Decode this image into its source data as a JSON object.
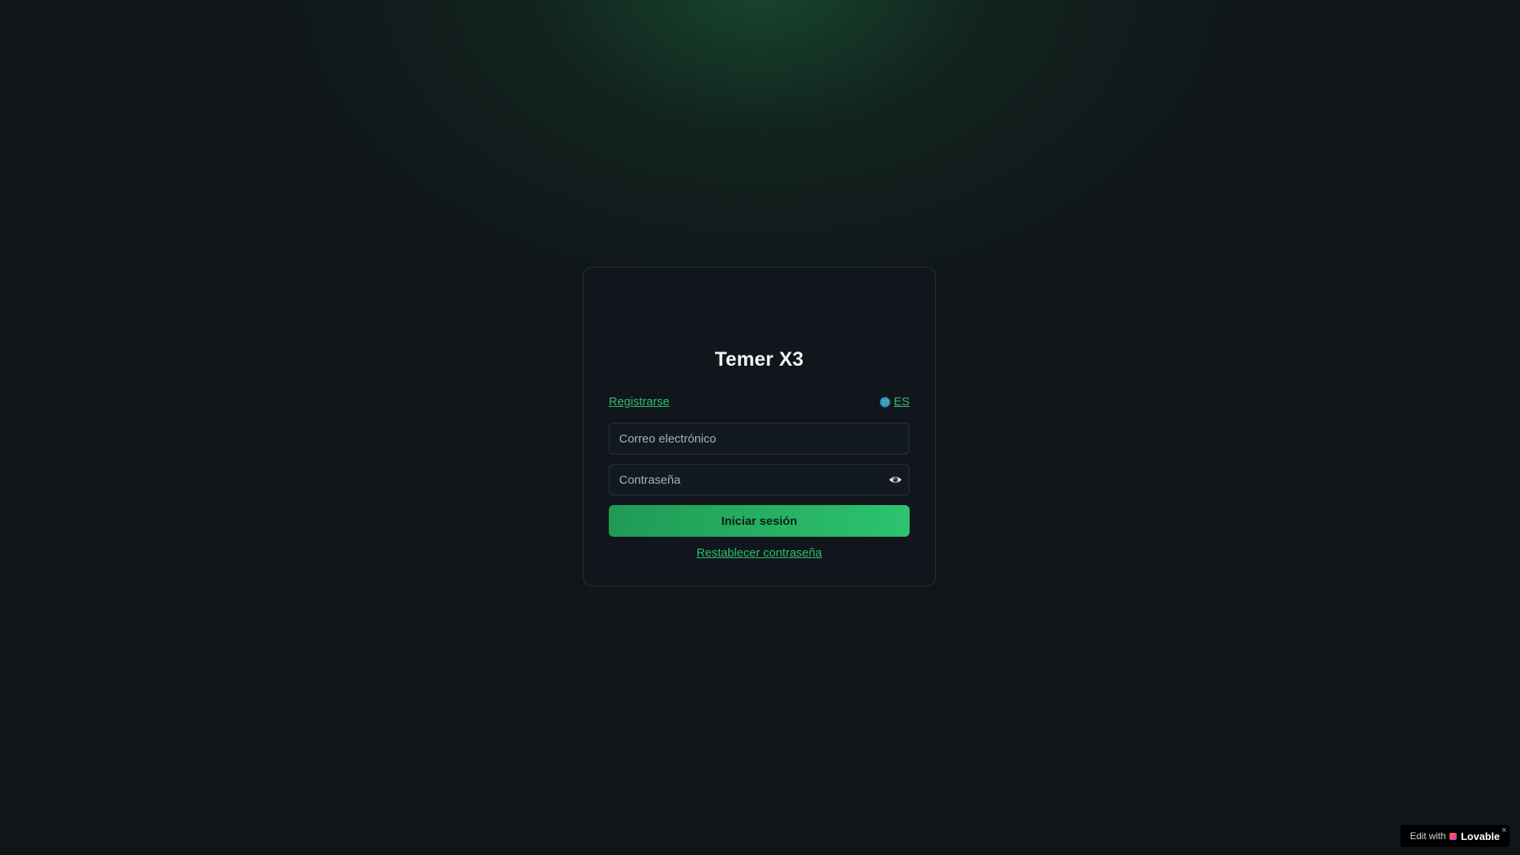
{
  "app": {
    "title": "Temer X3"
  },
  "links": {
    "register": "Registrarse",
    "language": "ES",
    "reset_password": "Restablecer contraseña"
  },
  "form": {
    "email_placeholder": "Correo electrónico",
    "email_value": "",
    "password_placeholder": "Contraseña",
    "password_value": "",
    "submit_label": "Iniciar sesión"
  },
  "icons": {
    "language": "globe-icon",
    "password_toggle": "eye-icon",
    "badge_logo": "heart-icon",
    "badge_close": "close-icon"
  },
  "badge": {
    "prefix": "Edit with",
    "brand": "Lovable",
    "close": "×"
  },
  "colors": {
    "background": "#101519",
    "accent": "#2cbf6c",
    "button_start": "#1f9a55",
    "button_end": "#2cc36e",
    "card_border": "#243038"
  }
}
